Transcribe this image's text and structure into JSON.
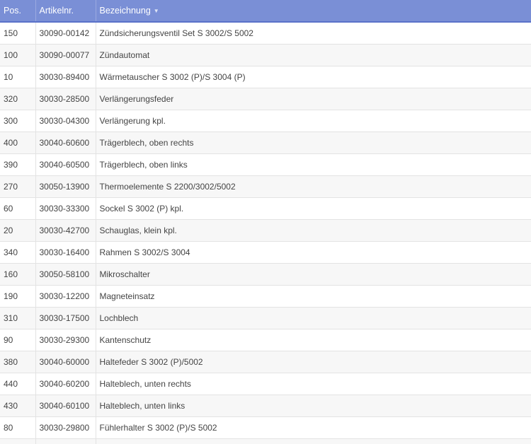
{
  "table": {
    "headers": {
      "pos": "Pos.",
      "artikelnr": "Artikelnr.",
      "bezeichnung": "Bezeichnung"
    },
    "sort": {
      "column": "bezeichnung",
      "direction": "descending",
      "icon": "chevron-down-icon"
    },
    "rows": [
      {
        "pos": "150",
        "artikelnr": "30090-00142",
        "bezeichnung": "Zündsicherungsventil Set S 3002/S 5002"
      },
      {
        "pos": "100",
        "artikelnr": "30090-00077",
        "bezeichnung": "Zündautomat"
      },
      {
        "pos": "10",
        "artikelnr": "30030-89400",
        "bezeichnung": "Wärmetauscher S 3002 (P)/S 3004 (P)"
      },
      {
        "pos": "320",
        "artikelnr": "30030-28500",
        "bezeichnung": "Verlängerungsfeder"
      },
      {
        "pos": "300",
        "artikelnr": "30030-04300",
        "bezeichnung": "Verlängerung kpl."
      },
      {
        "pos": "400",
        "artikelnr": "30040-60600",
        "bezeichnung": "Trägerblech, oben rechts"
      },
      {
        "pos": "390",
        "artikelnr": "30040-60500",
        "bezeichnung": "Trägerblech, oben links"
      },
      {
        "pos": "270",
        "artikelnr": "30050-13900",
        "bezeichnung": "Thermoelemente S 2200/3002/5002"
      },
      {
        "pos": "60",
        "artikelnr": "30030-33300",
        "bezeichnung": "Sockel S 3002 (P) kpl."
      },
      {
        "pos": "20",
        "artikelnr": "30030-42700",
        "bezeichnung": "Schauglas, klein kpl."
      },
      {
        "pos": "340",
        "artikelnr": "30030-16400",
        "bezeichnung": "Rahmen S 3002/S 3004"
      },
      {
        "pos": "160",
        "artikelnr": "30050-58100",
        "bezeichnung": "Mikroschalter"
      },
      {
        "pos": "190",
        "artikelnr": "30030-12200",
        "bezeichnung": "Magneteinsatz"
      },
      {
        "pos": "310",
        "artikelnr": "30030-17500",
        "bezeichnung": "Lochblech"
      },
      {
        "pos": "90",
        "artikelnr": "30030-29300",
        "bezeichnung": "Kantenschutz"
      },
      {
        "pos": "380",
        "artikelnr": "30040-60000",
        "bezeichnung": "Haltefeder S 3002 (P)/5002"
      },
      {
        "pos": "440",
        "artikelnr": "30040-60200",
        "bezeichnung": "Halteblech, unten rechts"
      },
      {
        "pos": "430",
        "artikelnr": "30040-60100",
        "bezeichnung": "Halteblech, unten links"
      },
      {
        "pos": "80",
        "artikelnr": "30030-29800",
        "bezeichnung": "Fühlerhalter S 3002 (P)/S 5002"
      },
      {
        "pos": "",
        "artikelnr": "",
        "bezeichnung": ""
      }
    ]
  },
  "colors": {
    "header_bg": "#7a8fd6",
    "header_text": "#ffffff",
    "row_alt": "#f7f7f7",
    "text": "#444444"
  }
}
